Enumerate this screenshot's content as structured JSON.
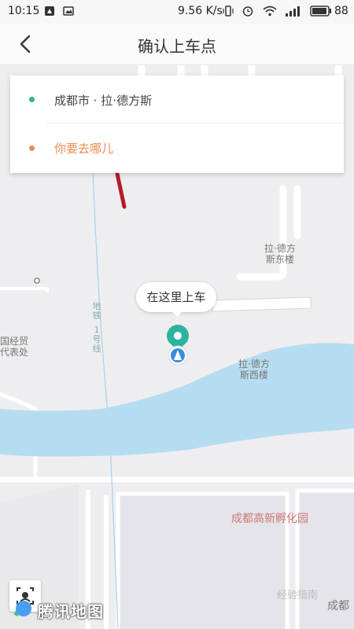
{
  "status_bar": {
    "time": "10:15",
    "speed": "9.56 K/s",
    "battery": "88",
    "icons": [
      "notification-icon",
      "image-icon",
      "vibrate-icon",
      "alarm-icon",
      "wifi-icon",
      "signal-icon",
      "battery-icon"
    ]
  },
  "header": {
    "title": "确认上车点",
    "back_icon": "chevron-left-icon"
  },
  "route_card": {
    "origin": "成都市 · 拉·德方斯",
    "origin_color": "#2cb3a0",
    "destination_placeholder": "你要去哪儿",
    "destination_color": "#f08a4b"
  },
  "map": {
    "pickup_bubble": "在这里上车",
    "labels": {
      "east_building": [
        "拉·德方",
        "斯东楼"
      ],
      "west_building": [
        "拉·德方",
        "斯西楼"
      ],
      "trade_office": [
        "国经贸",
        "代表处"
      ],
      "incubator": "成都高新孵化园",
      "corner": "成都",
      "metro_line": [
        "地",
        "铁",
        "1",
        "号",
        "线"
      ]
    },
    "water_color": "#b6dcf2",
    "accent_color": "#b31c2a"
  },
  "footer": {
    "logo_text": "腾讯地图",
    "watermark": "经验指南"
  }
}
